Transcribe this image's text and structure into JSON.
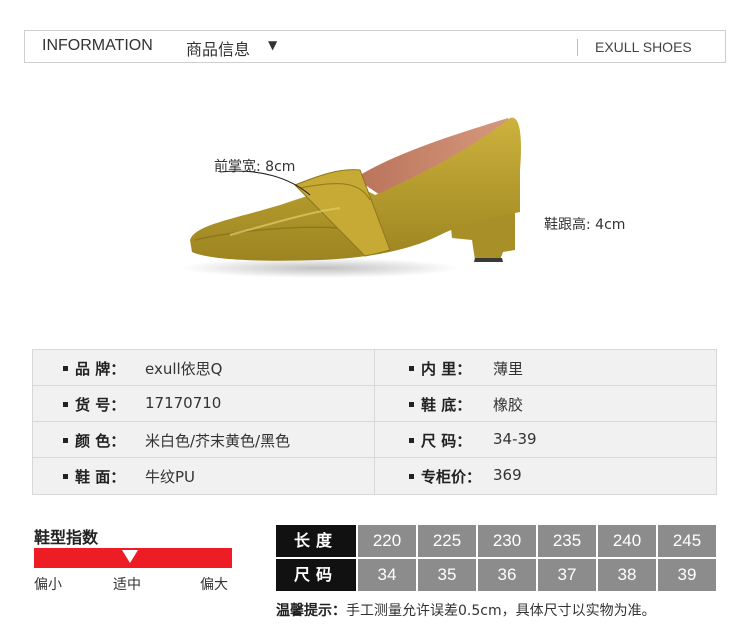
{
  "header": {
    "title_en": "INFORMATION",
    "title_cn": "商品信息",
    "arrow": "▼",
    "brand": "EXULL SHOES"
  },
  "measurements": {
    "forefoot_width": "前掌宽: 8cm",
    "heel_height": "鞋跟高: 4cm"
  },
  "colors": {
    "shoe_body": "#b59a2a",
    "shoe_lining": "#c8866a",
    "fit_bar": "#ee1c25",
    "size_head_bg": "#111111",
    "size_cell_bg": "#8c8c8c",
    "table_bg": "#f1f1f1"
  },
  "info": {
    "rows": [
      {
        "left": {
          "key": "品  牌：",
          "value": "exull依思Q"
        },
        "right": {
          "key": "内  里：",
          "value": "薄里"
        }
      },
      {
        "left": {
          "key": "货  号：",
          "value": "17170710"
        },
        "right": {
          "key": "鞋  底：",
          "value": "橡胶"
        }
      },
      {
        "left": {
          "key": "颜  色：",
          "value": "米白色/芥末黄色/黑色"
        },
        "right": {
          "key": "尺  码：",
          "value": "34-39"
        }
      },
      {
        "left": {
          "key": "鞋  面：",
          "value": "牛纹PU"
        },
        "right": {
          "key": "专柜价：",
          "value": "369"
        }
      }
    ]
  },
  "fit": {
    "title": "鞋型指数",
    "labels": [
      "偏小",
      "适中",
      "偏大"
    ],
    "selected": "适中"
  },
  "size_table": {
    "length_label": "长度",
    "size_label": "尺码",
    "lengths": [
      "220",
      "225",
      "230",
      "235",
      "240",
      "245"
    ],
    "sizes": [
      "34",
      "35",
      "36",
      "37",
      "38",
      "39"
    ],
    "note_label": "温馨提示：",
    "note_text": "手工测量允许误差0.5cm，具体尺寸以实物为准。"
  }
}
